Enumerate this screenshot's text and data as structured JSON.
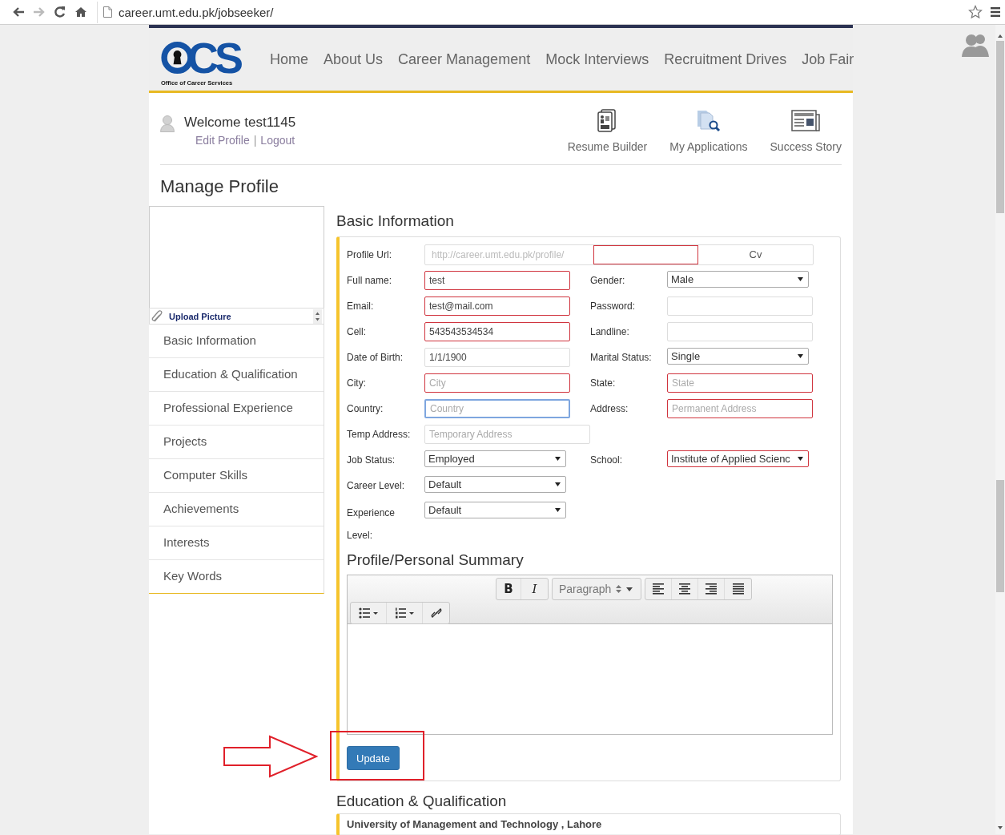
{
  "browser": {
    "nav_buttons": [
      {
        "kind": "back",
        "disabled": false
      },
      {
        "kind": "forward",
        "disabled": true
      },
      {
        "kind": "reload",
        "disabled": false
      },
      {
        "kind": "home",
        "disabled": false
      }
    ],
    "url": "career.umt.edu.pk/jobseeker/"
  },
  "site": {
    "logo": {
      "mark": "CS",
      "tagline": "Office of Career Services"
    },
    "nav": [
      "Home",
      "About Us",
      "Career Management",
      "Mock Interviews",
      "Recruitment Drives",
      "Job Fair"
    ]
  },
  "user": {
    "welcome": "Welcome test1145",
    "links": [
      "Edit Profile",
      "Logout"
    ],
    "separator": "|"
  },
  "quick_links": [
    {
      "kind": "resume",
      "label": "Resume Builder"
    },
    {
      "kind": "applications",
      "label": "My Applications"
    },
    {
      "kind": "stories",
      "label": "Success Story"
    }
  ],
  "page_title": "Manage Profile",
  "sidebar": {
    "upload_label": "Upload Picture",
    "items": [
      {
        "label": "Basic Information",
        "selected": false
      },
      {
        "label": "Education & Qualification",
        "selected": false
      },
      {
        "label": "Professional Experience",
        "selected": false
      },
      {
        "label": "Projects",
        "selected": false
      },
      {
        "label": "Computer Skills",
        "selected": false
      },
      {
        "label": "Achievements",
        "selected": false
      },
      {
        "label": "Interests",
        "selected": false
      },
      {
        "label": "Key Words",
        "selected": false
      }
    ]
  },
  "basic_info": {
    "title": "Basic Information",
    "url_field": {
      "label": "Profile Url:",
      "prefix": "http://career.umt.edu.pk/profile/",
      "suffix": "Cv",
      "invalid": true
    },
    "rows": [
      {
        "left": {
          "label": "Full name:",
          "kind": "text",
          "value": "test",
          "invalid": true
        },
        "right": {
          "label": "Gender:",
          "kind": "select",
          "value": "Male",
          "invalid": false
        }
      },
      {
        "left": {
          "label": "Email:",
          "kind": "text",
          "value": "test@mail.com",
          "invalid": true
        },
        "right": {
          "label": "Password:",
          "kind": "text",
          "invalid": false
        }
      },
      {
        "left": {
          "label": "Cell:",
          "kind": "text",
          "value": "543543534534",
          "invalid": true
        },
        "right": {
          "label": "Landline:",
          "kind": "text",
          "invalid": false
        }
      },
      {
        "left": {
          "label": "Date of Birth:",
          "kind": "text",
          "value": "1/1/1900",
          "invalid": false
        },
        "right": {
          "label": "Marital Status:",
          "kind": "select",
          "value": "Single",
          "invalid": false
        }
      },
      {
        "left": {
          "label": "City:",
          "kind": "text",
          "placeholder": "City",
          "invalid": true
        },
        "right": {
          "label": "State:",
          "kind": "text",
          "placeholder": "State",
          "invalid": true
        }
      },
      {
        "left": {
          "label": "Country:",
          "kind": "text",
          "placeholder": "Country",
          "invalid": false,
          "focused": true
        },
        "right": {
          "label": "Address:",
          "kind": "text",
          "placeholder": "Permanent Address",
          "invalid": true
        }
      },
      {
        "left": {
          "label": "Temp Address:",
          "kind": "text",
          "placeholder": "Temporary Address",
          "invalid": false,
          "wide": true
        }
      },
      {
        "left": {
          "label": "Job Status:",
          "kind": "select",
          "value": "Employed",
          "invalid": false
        },
        "right": {
          "label": "School:",
          "kind": "select",
          "value": "Institute of Applied Scienc",
          "invalid": true
        }
      },
      {
        "left": {
          "label": "Career Level:",
          "kind": "select",
          "value": "Default",
          "invalid": false
        }
      },
      {
        "left": {
          "label": "Experience Level:",
          "kind": "select",
          "value": "Default",
          "invalid": false
        }
      }
    ]
  },
  "summary": {
    "title": "Profile/Personal Summary",
    "toolbar": {
      "bold": "B",
      "italic": "I",
      "format": "Paragraph"
    }
  },
  "update_button": "Update",
  "education": {
    "title": "Education & Qualification",
    "items": [
      "University of Management and Technology , Lahore"
    ]
  },
  "annotations": {
    "arrow": true,
    "highlight_box": true
  }
}
